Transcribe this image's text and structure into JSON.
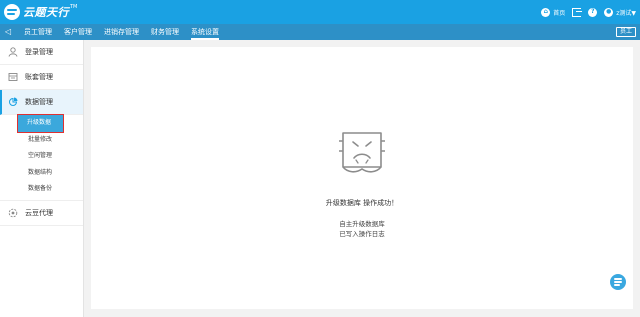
{
  "app": {
    "logo_text": "云题天行",
    "logo_tm": "TM",
    "brand_color": "#1aa1e3"
  },
  "header": {
    "links": [
      {
        "label": "首页",
        "icon": "home-icon"
      },
      {
        "label": "",
        "icon": "logout-icon"
      },
      {
        "label": "",
        "icon": "help-icon"
      },
      {
        "label": "z测试▼",
        "icon": "user-icon"
      }
    ]
  },
  "nav": {
    "back_icon": "chevron-left-icon",
    "tabs": [
      {
        "label": "员工管理"
      },
      {
        "label": "客户管理"
      },
      {
        "label": "进销存管理"
      },
      {
        "label": "财务管理"
      },
      {
        "label": "系统设置",
        "active": true
      }
    ],
    "badge": "员工"
  },
  "sidebar": {
    "groups": [
      {
        "label": "登录管理",
        "icon": "user-icon"
      },
      {
        "label": "账套管理",
        "icon": "ledger-icon"
      },
      {
        "label": "数据管理",
        "icon": "pie-chart-icon",
        "active": true,
        "items": [
          {
            "label": "升级数据",
            "selected": true
          },
          {
            "label": "批量修改"
          },
          {
            "label": "空闲管理"
          },
          {
            "label": "数据结构"
          },
          {
            "label": "数据备份"
          }
        ]
      },
      {
        "label": "云豆代理",
        "icon": "cloud-bean-icon"
      }
    ]
  },
  "main": {
    "message": "升级数据库 操作成功！",
    "detail_1": "自主升级数据库",
    "detail_2": "已写入操作日志"
  },
  "float_button": {
    "icon": "service-icon"
  }
}
